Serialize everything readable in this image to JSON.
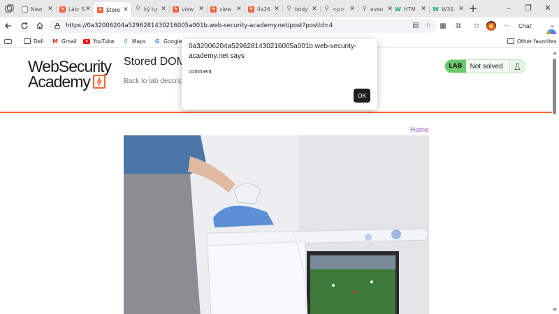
{
  "browser": {
    "tabs": [
      {
        "title": "New",
        "icon": "new-tab-page-icon"
      },
      {
        "title": "Lab: S",
        "icon": "portswigger-icon"
      },
      {
        "title": "Store",
        "icon": "portswigger-icon",
        "active": true
      },
      {
        "title": "ký tự",
        "icon": "search-icon"
      },
      {
        "title": "view",
        "icon": "portswigger-icon"
      },
      {
        "title": "view",
        "icon": "portswigger-icon"
      },
      {
        "title": "0a26",
        "icon": "portswigger-icon"
      },
      {
        "title": "body",
        "icon": "search-icon"
      },
      {
        "title": "<p>",
        "icon": "search-icon"
      },
      {
        "title": "even",
        "icon": "search-icon"
      },
      {
        "title": "HTM",
        "icon": "w3schools-icon"
      },
      {
        "title": "W3S",
        "icon": "w3schools-icon"
      }
    ],
    "address": {
      "url": "https://0a32006204a5296281430216005a001b.web-security-academy.net/post?postId=4"
    },
    "copilot_label": "Chat",
    "favorites": [
      {
        "label": "Dell",
        "icon": "folder-icon"
      },
      {
        "label": "Gmail",
        "icon": "gmail-icon"
      },
      {
        "label": "YouTube",
        "icon": "youtube-icon"
      },
      {
        "label": "Maps",
        "icon": "maps-icon"
      },
      {
        "label": "Google",
        "icon": "google-icon"
      }
    ],
    "other_favorites": "Other favorites"
  },
  "site": {
    "logo_line1": "WebSecurity",
    "logo_line2": "Academy",
    "lab_title": "Stored DOM",
    "back_link": "Back to lab descrip",
    "lab_badge": "LAB",
    "lab_state": "Not solved",
    "home_link": "Home"
  },
  "dialog": {
    "origin": "0a32006204a5296281430216005a001b.web-security-academy.net says",
    "message": "comment",
    "ok_label": "OK"
  },
  "colors": {
    "accent": "#ff6633",
    "lab_green": "#6cc86c",
    "home_link": "#9b59b6"
  }
}
